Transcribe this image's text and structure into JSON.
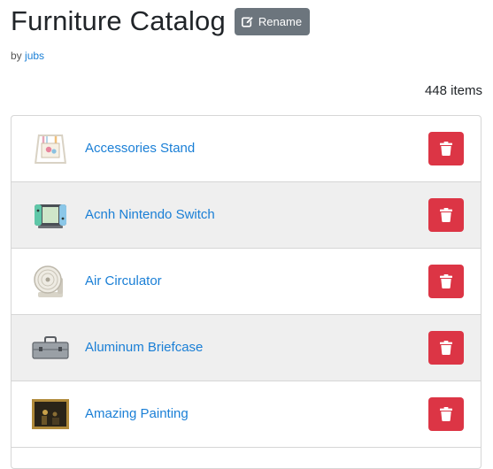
{
  "page": {
    "title": "Furniture Catalog",
    "rename_label": "Rename",
    "by_label": "by",
    "author": "jubs",
    "item_count": "448 items"
  },
  "items": [
    {
      "name": "Accessories Stand",
      "icon": "accessories-stand-icon"
    },
    {
      "name": "Acnh Nintendo Switch",
      "icon": "nintendo-switch-icon"
    },
    {
      "name": "Air Circulator",
      "icon": "air-circulator-icon"
    },
    {
      "name": "Aluminum Briefcase",
      "icon": "briefcase-icon"
    },
    {
      "name": "Amazing Painting",
      "icon": "painting-icon"
    }
  ],
  "colors": {
    "link": "#1a7fd6",
    "delete": "#dc3545",
    "rename": "#6c757d",
    "row_alt": "#efefef"
  }
}
